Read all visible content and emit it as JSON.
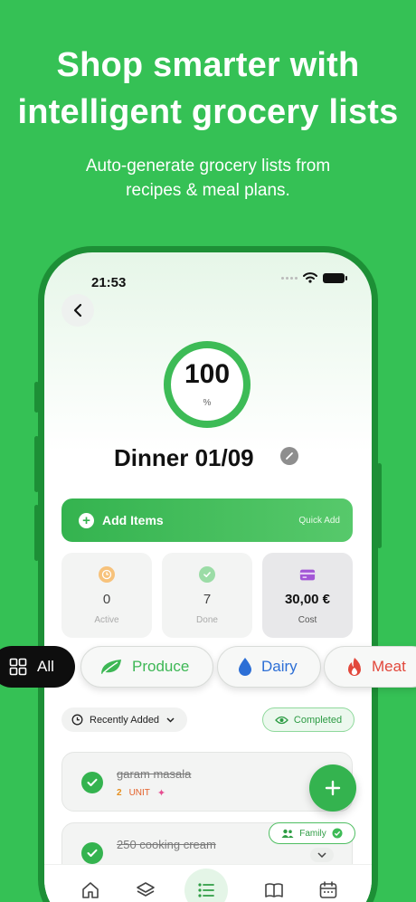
{
  "promo": {
    "headline_line1": "Shop smarter with",
    "headline_line2": "intelligent grocery lists",
    "sub_line1": "Auto-generate grocery lists  from",
    "sub_line2": "recipes &  meal plans."
  },
  "status_bar": {
    "time": "21:53"
  },
  "progress": {
    "value": "100",
    "unit": "%",
    "fraction": 1.0
  },
  "list": {
    "title": "Dinner 01/09"
  },
  "add_items": {
    "label": "Add Items",
    "quick_label": "Quick Add"
  },
  "stats": {
    "active": {
      "value": "0",
      "label": "Active"
    },
    "done": {
      "value": "7",
      "label": "Done"
    },
    "cost": {
      "value": "30,00 €",
      "label": "Cost"
    }
  },
  "categories": [
    {
      "label": "All",
      "icon": "grid-icon"
    },
    {
      "label": "Produce",
      "icon": "leaf-icon"
    },
    {
      "label": "Dairy",
      "icon": "drop-icon"
    },
    {
      "label": "Meat",
      "icon": "flame-icon"
    }
  ],
  "filters": {
    "sort_label": "Recently Added",
    "completed_label": "Completed"
  },
  "items": [
    {
      "name": "garam masala",
      "qty": "2",
      "unit": "UNIT"
    },
    {
      "name": "250 cooking cream"
    }
  ],
  "family_badge": {
    "label": "Family"
  },
  "tabs": [
    "home-icon",
    "layers-icon",
    "list-icon",
    "book-icon",
    "calendar-icon"
  ],
  "colors": {
    "background": "#35c155",
    "accent": "#34b34f",
    "text": "#111111"
  }
}
